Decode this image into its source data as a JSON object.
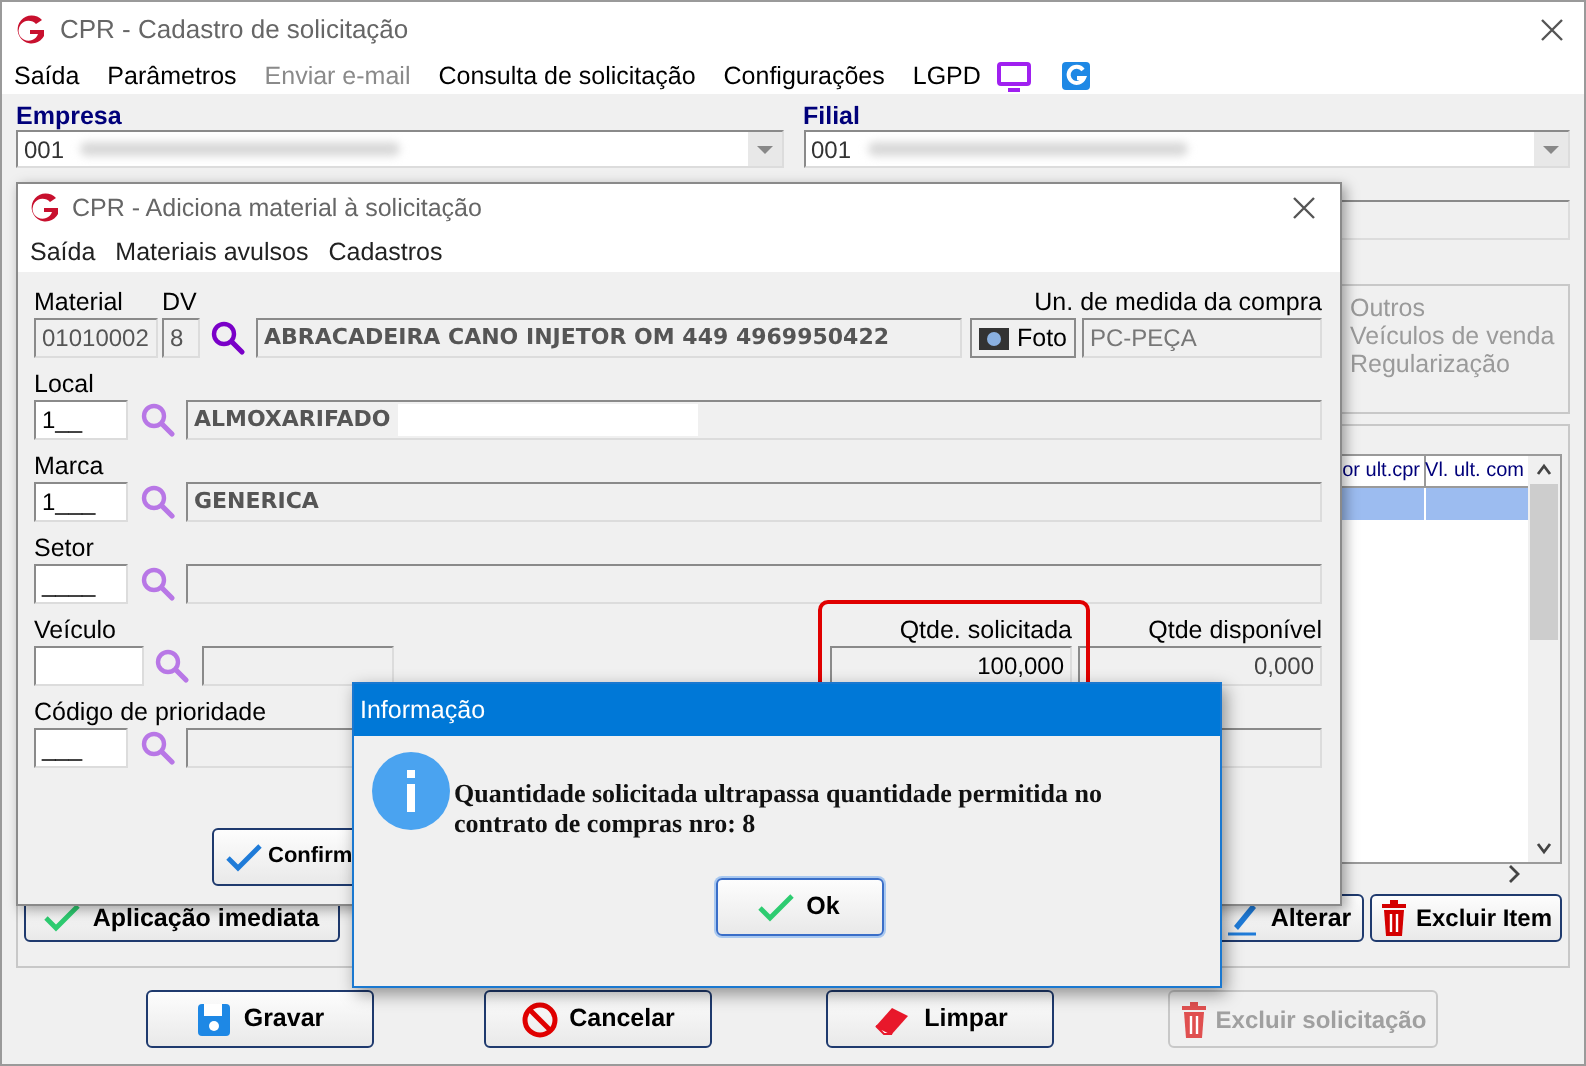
{
  "main_window": {
    "title": "CPR - Cadastro de solicitação",
    "menu": [
      {
        "label": "Saída",
        "disabled": false
      },
      {
        "label": "Parâmetros",
        "disabled": false
      },
      {
        "label": "Enviar e-mail",
        "disabled": true
      },
      {
        "label": "Consulta de solicitação",
        "disabled": false
      },
      {
        "label": "Configurações",
        "disabled": false
      },
      {
        "label": "LGPD",
        "disabled": false
      }
    ],
    "empresa": {
      "label": "Empresa",
      "value": "001"
    },
    "filial": {
      "label": "Filial",
      "value": "001"
    },
    "options": [
      {
        "label": "Outros",
        "disabled": true
      },
      {
        "label": "Veículos de venda",
        "disabled": true
      },
      {
        "label": "Regularização",
        "disabled": true
      }
    ],
    "table": {
      "columns": [
        "or ult.cpr",
        "Vl. ult. com"
      ],
      "rows": [
        {
          "selected": true
        }
      ]
    },
    "item_buttons": [
      {
        "label": "Aplicação imediata"
      },
      {
        "label": "Alterar"
      },
      {
        "label": "Excluir Item"
      }
    ],
    "buttons": [
      {
        "label": "Gravar",
        "disabled": false
      },
      {
        "label": "Cancelar",
        "disabled": false
      },
      {
        "label": "Limpar",
        "disabled": false
      },
      {
        "label": "Excluir solicitação",
        "disabled": true
      }
    ]
  },
  "material_window": {
    "title": "CPR - Adiciona material à solicitação",
    "menu": [
      "Saída",
      "Materiais avulsos",
      "Cadastros"
    ],
    "material": {
      "label": "Material",
      "code": "01010002",
      "dv_label": "DV",
      "dv": "8",
      "description": "ABRACADEIRA CANO INJETOR OM 449 4969950422",
      "photo_button": "Foto",
      "unit_label": "Un. de medida da compra",
      "unit": "PC-PEÇA"
    },
    "lookups": [
      {
        "label": "Local",
        "code": "1__",
        "description": "ALMOXARIFADO"
      },
      {
        "label": "Marca",
        "code": "1___",
        "description": "GENERICA"
      },
      {
        "label": "Setor",
        "code": "____"
      }
    ],
    "vehicle": {
      "label": "Veículo"
    },
    "qty_requested": {
      "label": "Qtde. solicitada",
      "value": "100,000",
      "highlighted": true
    },
    "qty_available": {
      "label": "Qtde disponível",
      "value": "0,000"
    },
    "priority": {
      "label": "Código de prioridade",
      "code": "___"
    },
    "confirm_button": "Confirm"
  },
  "dialog": {
    "title": "Informação",
    "message": "Quantidade solicitada ultrapassa quantidade permitida no contrato de compras nro: 8",
    "ok_button": "Ok"
  }
}
